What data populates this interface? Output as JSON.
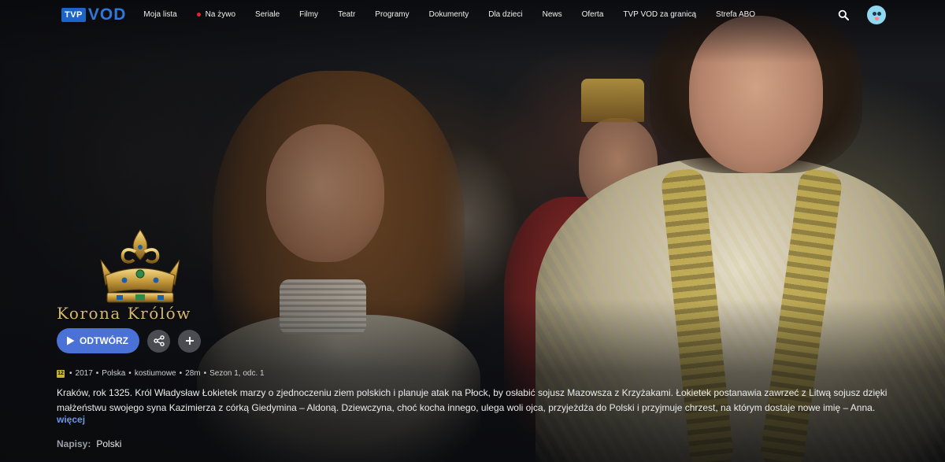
{
  "nav": {
    "logo_tvp": "TVP",
    "logo_vod": "VOD",
    "items": [
      {
        "label": "Moja lista",
        "live": false
      },
      {
        "label": "Na żywo",
        "live": true
      },
      {
        "label": "Seriale",
        "live": false
      },
      {
        "label": "Filmy",
        "live": false
      },
      {
        "label": "Teatr",
        "live": false
      },
      {
        "label": "Programy",
        "live": false
      },
      {
        "label": "Dokumenty",
        "live": false
      },
      {
        "label": "Dla dzieci",
        "live": false
      },
      {
        "label": "News",
        "live": false
      },
      {
        "label": "Oferta",
        "live": false
      },
      {
        "label": "TVP VOD za granicą",
        "live": false
      },
      {
        "label": "Strefa ABO",
        "live": false
      }
    ],
    "search_icon": "search-icon",
    "avatar_icon": "avatar-icon"
  },
  "title": {
    "wordmark": "Korona Królów",
    "emblem": "crown-emblem"
  },
  "actions": {
    "play_label": "ODTWÓRZ",
    "play_icon": "play-icon",
    "share_icon": "share-icon",
    "add_icon": "plus-icon"
  },
  "meta": {
    "age_rating": "12",
    "year": "2017",
    "country": "Polska",
    "genre": "kostiumowe",
    "duration": "28m",
    "episode": "Sezon 1, odc. 1",
    "separator": "•"
  },
  "description": "Kraków, rok 1325. Król Władysław Łokietek marzy o zjednoczeniu ziem polskich i planuje atak na Płock, by osłabić sojusz Mazowsza z Krzyżakami. Łokietek postanawia zawrzeć z Litwą sojusz dzięki małżeństwu swojego syna Kazimierza z córką Giedymina – Aldoną. Dziewczyna, choć kocha innego, ulega woli ojca, przyjeżdża do Polski i przyjmuje chrzest, na którym dostaje nowe imię – Anna.",
  "more_label": "więcej",
  "subtitles": {
    "label": "Napisy:",
    "value": "Polski"
  },
  "colors": {
    "accent": "#4a71d6",
    "link": "#6f93ee",
    "live": "#e3262c",
    "logo_blue": "#2f78d9",
    "gold": "#d7b96a"
  }
}
